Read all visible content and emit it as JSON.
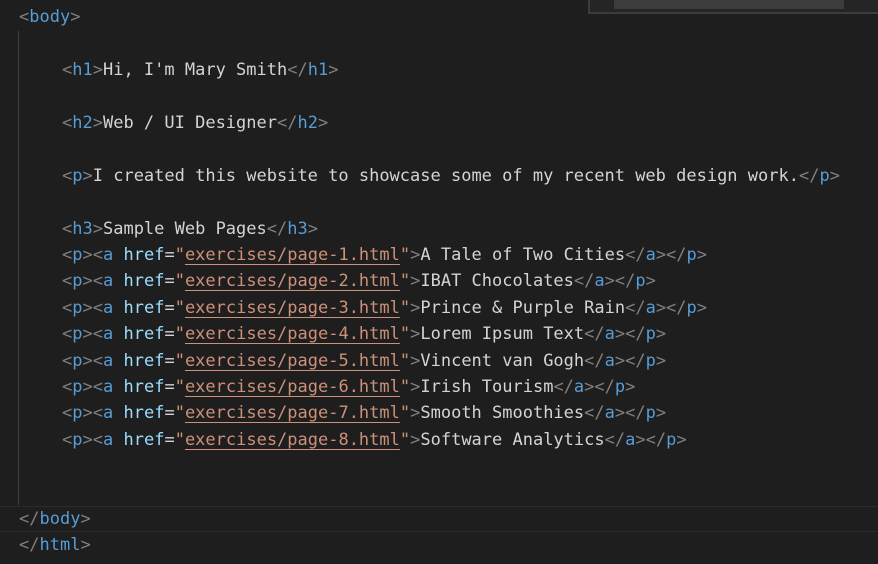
{
  "code": {
    "body_open": "body",
    "h1": {
      "tag": "h1",
      "text": "Hi, I'm Mary Smith"
    },
    "h2": {
      "tag": "h2",
      "text": "Web / UI Designer"
    },
    "p_intro": {
      "tag": "p",
      "text": "I created this website to showcase some of my recent web design work."
    },
    "h3": {
      "tag": "h3",
      "text": "Sample Web Pages"
    },
    "links": [
      {
        "href": "exercises/page-1.html",
        "label": "A Tale of Two Cities"
      },
      {
        "href": "exercises/page-2.html",
        "label": "IBAT Chocolates"
      },
      {
        "href": "exercises/page-3.html",
        "label": "Prince & Purple Rain"
      },
      {
        "href": "exercises/page-4.html",
        "label": "Lorem Ipsum Text"
      },
      {
        "href": "exercises/page-5.html",
        "label": "Vincent van Gogh"
      },
      {
        "href": "exercises/page-6.html",
        "label": "Irish Tourism"
      },
      {
        "href": "exercises/page-7.html",
        "label": "Smooth Smoothies"
      },
      {
        "href": "exercises/page-8.html",
        "label": "Software Analytics"
      }
    ],
    "body_close": "body",
    "html_close": "html",
    "tag_p": "p",
    "tag_a": "a",
    "attr_href": "href"
  },
  "colors": {
    "background": "#1e1e1e",
    "tag": "#569cd6",
    "punct": "#808080",
    "attr": "#9cdcfe",
    "string": "#ce9178",
    "text": "#d4d4d4"
  }
}
